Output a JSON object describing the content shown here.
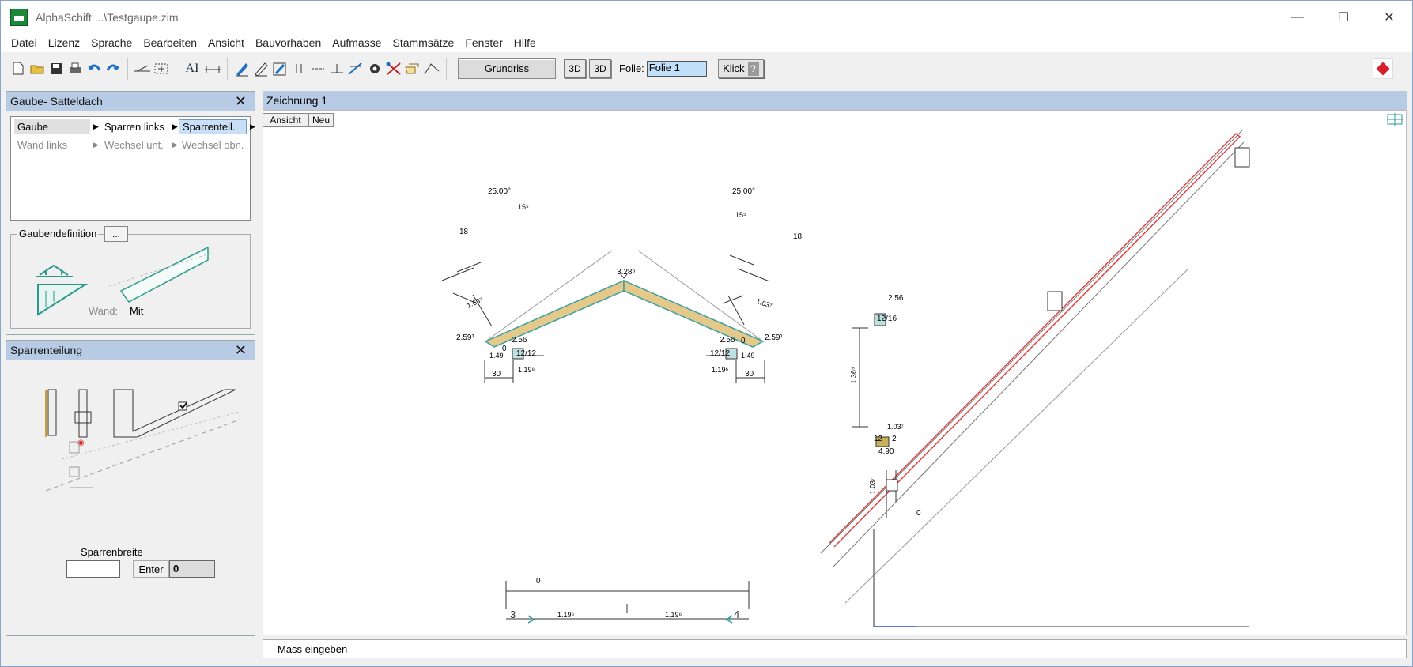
{
  "window": {
    "title": "AlphaSchift ...\\Testgaupe.zim"
  },
  "menu": [
    "Datei",
    "Lizenz",
    "Sprache",
    "Bearbeiten",
    "Ansicht",
    "Bauvorhaben",
    "Aufmasse",
    "Stammsätze",
    "Fenster",
    "Hilfe"
  ],
  "toolbar": {
    "grundriss_label": "Grundriss",
    "btn_3d_a": "3D",
    "btn_3d_b": "3D",
    "folie_label": "Folie:",
    "folie_value": "Folie 1",
    "klick_label": "Klick",
    "klick_help": "?",
    "text_tool": "AI"
  },
  "panel_gaube": {
    "title": "Gaube- Satteldach",
    "close": "✕",
    "nav_row1": [
      "Gaube",
      "Sparren links",
      "Sparrenteil."
    ],
    "nav_row2": [
      "Wand links",
      "Wechsel unt.",
      "Wechsel obn."
    ],
    "group_label": "Gaubendefinition",
    "group_button": "...",
    "wand_label": "Wand:",
    "wand_value": "Mit"
  },
  "panel_sparren": {
    "title": "Sparrenteilung",
    "close": "✕",
    "breite_label": "Sparrenbreite",
    "breite_value": "",
    "enter_label": "Enter",
    "count_value": "0"
  },
  "drawing": {
    "title": "Zeichnung 1",
    "btn_ansicht": "Ansicht",
    "btn_neu": "Neu",
    "labels": {
      "angle_l": "25.00°",
      "angle_r": "25.00°",
      "d15_l": "15⁵",
      "d15_r": "15⁵",
      "d18_l": "18",
      "d18_r": "18",
      "top": "3.28⁵",
      "l_len": "1.63⁷",
      "r_len": "1.63⁷",
      "l_259": "2.59¹",
      "r_259": "2.59¹",
      "l_256": "2.56",
      "r_256": "2.56",
      "l_0": "0",
      "r_0": "0",
      "l_149": "1.49",
      "r_149": "1.49",
      "l_1212": "12/12",
      "r_1212": "12/12",
      "l_30": "30",
      "r_30": "30",
      "l_1196": "1.19⁶",
      "r_1196": "1.19⁶",
      "b_0": "0",
      "b_1196a": "1.19⁶",
      "b_1196b": "1.19⁶",
      "b_3": "3",
      "b_4": "4",
      "s_256": "2.56",
      "s_1216": "12/16",
      "s_136": "1.36⁵",
      "s_1037": "1.03⁷",
      "s_12": "12",
      "s_2": "2",
      "s_490": "4.90",
      "s_1037b": "1.03⁷",
      "s_0": "0"
    }
  },
  "status": {
    "text": "Mass eingeben"
  }
}
